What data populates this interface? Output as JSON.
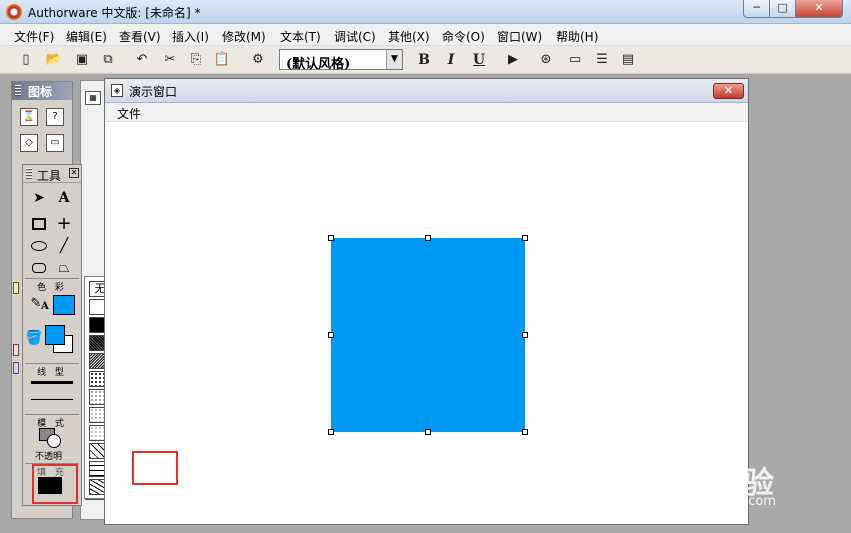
{
  "window": {
    "title": "Authorware 中文版: [未命名] *"
  },
  "window_buttons": {
    "minimize": "─",
    "maximize": "□",
    "close": "✕"
  },
  "menu": [
    {
      "label": "文件(F)"
    },
    {
      "label": "编辑(E)"
    },
    {
      "label": "查看(V)"
    },
    {
      "label": "插入(I)"
    },
    {
      "label": "修改(M)"
    },
    {
      "label": "文本(T)"
    },
    {
      "label": "调试(C)"
    },
    {
      "label": "其他(X)"
    },
    {
      "label": "命令(O)"
    },
    {
      "label": "窗口(W)"
    },
    {
      "label": "帮助(H)"
    }
  ],
  "toolbar": {
    "style_select": {
      "value": "(默认风格)"
    },
    "bold_label": "B",
    "italic_label": "I",
    "underline_label": "U"
  },
  "icon_palette": {
    "title": "图标"
  },
  "tools_palette": {
    "title": "工具",
    "color_section": "色 彩",
    "line_section": "线 型",
    "mode_section": "模 式",
    "mode_value": "不透明",
    "fill_section": "填 充",
    "text_tool_label": "A",
    "pen_text_label": "A"
  },
  "fill_panel": {
    "none_label": "无"
  },
  "presentation_window": {
    "title": "演示窗口",
    "menu_file": "文件"
  },
  "canvas": {
    "shape_color": "#0098F5",
    "stroke_color": "#0098F5",
    "fill_color": "#000000"
  },
  "watermark": {
    "main": "Bai 经验",
    "sub": "jingyan.baidu.com"
  }
}
